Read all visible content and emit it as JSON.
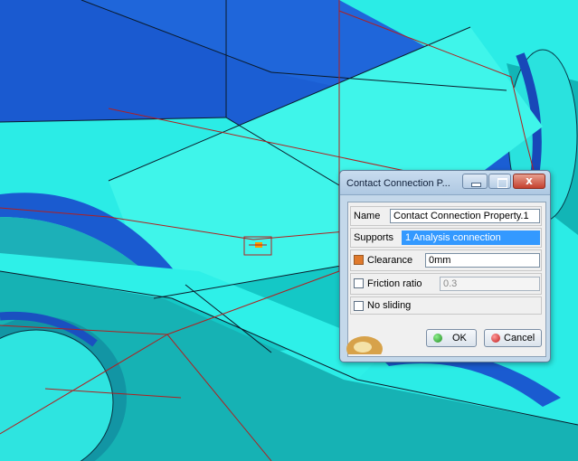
{
  "dialog": {
    "title": "Contact Connection P...",
    "window_buttons": {
      "minimize_icon": "minimize-icon",
      "maximize_icon": "maximize-icon",
      "close_icon": "close-icon",
      "close_glyph": "x"
    },
    "name_label": "Name",
    "name_value": "Contact Connection Property.1",
    "supports_label": "Supports",
    "supports_value": "1 Analysis connection",
    "clearance_label": "Clearance",
    "clearance_checked": true,
    "clearance_value": "0mm",
    "friction_label": "Friction ratio",
    "friction_checked": false,
    "friction_value": "0.3",
    "no_sliding_label": "No sliding",
    "no_sliding_checked": false,
    "ok_label": "OK",
    "cancel_label": "Cancel"
  },
  "colors": {
    "cyan_face": "#28f0e6",
    "blue_face": "#1e64d6",
    "teal_face": "#10b8b8",
    "edge_red": "#b02020",
    "marker_orange": "#ff9a00"
  }
}
